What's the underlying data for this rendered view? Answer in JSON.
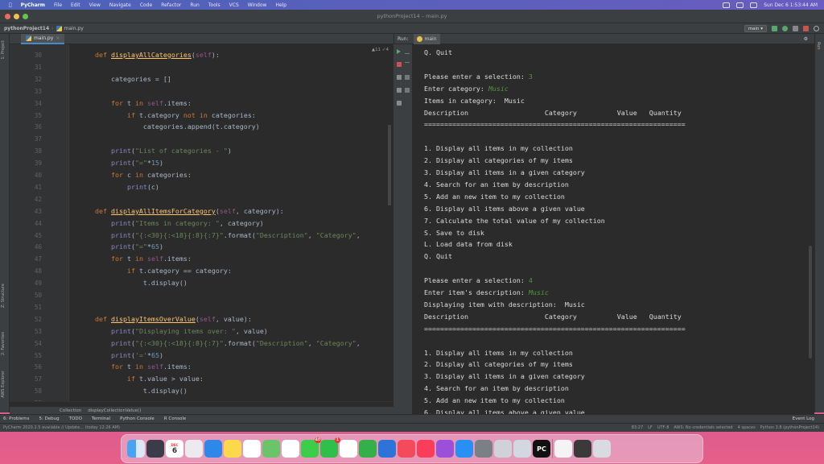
{
  "menubar": {
    "app": "PyCharm",
    "items": [
      "File",
      "Edit",
      "View",
      "Navigate",
      "Code",
      "Refactor",
      "Run",
      "Tools",
      "VCS",
      "Window",
      "Help"
    ],
    "clock": "Sun Dec 6  1:53:44 AM"
  },
  "window": {
    "title": "pythonProject14 – main.py"
  },
  "navbar": {
    "project": "pythonProject14",
    "file": "main.py",
    "run_config": "main"
  },
  "editor": {
    "tab": "main.py",
    "inspections": "▲11 ✓4",
    "lines": [
      {
        "n": "30",
        "t": [
          [
            "    ",
            "p"
          ],
          [
            "def ",
            "kw"
          ],
          [
            "displayAllCategories",
            "fnu"
          ],
          [
            "(",
            "p"
          ],
          [
            "self",
            "sf"
          ],
          [
            "):",
            "p"
          ]
        ]
      },
      {
        "n": "31",
        "t": []
      },
      {
        "n": "32",
        "t": [
          [
            "        categories = []",
            "p"
          ]
        ]
      },
      {
        "n": "33",
        "t": []
      },
      {
        "n": "34",
        "t": [
          [
            "        ",
            "p"
          ],
          [
            "for ",
            "kw"
          ],
          [
            "t ",
            "p"
          ],
          [
            "in ",
            "kw"
          ],
          [
            "self",
            "sf"
          ],
          [
            ".items:",
            "p"
          ]
        ]
      },
      {
        "n": "35",
        "t": [
          [
            "            ",
            "p"
          ],
          [
            "if ",
            "kw"
          ],
          [
            "t.category ",
            "p"
          ],
          [
            "not in ",
            "kw"
          ],
          [
            "categories:",
            "p"
          ]
        ]
      },
      {
        "n": "36",
        "t": [
          [
            "                categories.append(t.category)",
            "p"
          ]
        ]
      },
      {
        "n": "37",
        "t": []
      },
      {
        "n": "38",
        "t": [
          [
            "        ",
            "p"
          ],
          [
            "print",
            "nb"
          ],
          [
            "(",
            "p"
          ],
          [
            "\"List of categories - \"",
            "st"
          ],
          [
            ")",
            "p"
          ]
        ]
      },
      {
        "n": "39",
        "t": [
          [
            "        ",
            "p"
          ],
          [
            "print",
            "nb"
          ],
          [
            "(",
            "p"
          ],
          [
            "\"=\"",
            "st"
          ],
          [
            "*",
            "p"
          ],
          [
            "15",
            "num"
          ],
          [
            ")",
            "p"
          ]
        ]
      },
      {
        "n": "40",
        "t": [
          [
            "        ",
            "p"
          ],
          [
            "for ",
            "kw"
          ],
          [
            "c ",
            "p"
          ],
          [
            "in ",
            "kw"
          ],
          [
            "categories:",
            "p"
          ]
        ]
      },
      {
        "n": "41",
        "t": [
          [
            "            ",
            "p"
          ],
          [
            "print",
            "nb"
          ],
          [
            "(c)",
            "p"
          ]
        ]
      },
      {
        "n": "42",
        "t": []
      },
      {
        "n": "43",
        "t": [
          [
            "    ",
            "p"
          ],
          [
            "def ",
            "kw"
          ],
          [
            "displayAllItemsForCategory",
            "fnu"
          ],
          [
            "(",
            "p"
          ],
          [
            "self",
            "sf"
          ],
          [
            ", category):",
            "p"
          ]
        ]
      },
      {
        "n": "44",
        "t": [
          [
            "        ",
            "p"
          ],
          [
            "print",
            "nb"
          ],
          [
            "(",
            "p"
          ],
          [
            "\"Items in category: \"",
            "st"
          ],
          [
            ", category)",
            "p"
          ]
        ]
      },
      {
        "n": "45",
        "t": [
          [
            "        ",
            "p"
          ],
          [
            "print",
            "nb"
          ],
          [
            "(",
            "p"
          ],
          [
            "\"{:<30}{:<18}{:8}{:7}\"",
            "st"
          ],
          [
            ".format(",
            "p"
          ],
          [
            "\"Description\"",
            "st"
          ],
          [
            ", ",
            "p"
          ],
          [
            "\"Category\"",
            "st"
          ],
          [
            ",",
            "p"
          ]
        ]
      },
      {
        "n": "46",
        "t": [
          [
            "        ",
            "p"
          ],
          [
            "print",
            "nb"
          ],
          [
            "(",
            "p"
          ],
          [
            "\"=\"",
            "st"
          ],
          [
            "*",
            "p"
          ],
          [
            "65",
            "num"
          ],
          [
            ")",
            "p"
          ]
        ]
      },
      {
        "n": "47",
        "t": [
          [
            "        ",
            "p"
          ],
          [
            "for ",
            "kw"
          ],
          [
            "t ",
            "p"
          ],
          [
            "in ",
            "kw"
          ],
          [
            "self",
            "sf"
          ],
          [
            ".items:",
            "p"
          ]
        ]
      },
      {
        "n": "48",
        "t": [
          [
            "            ",
            "p"
          ],
          [
            "if ",
            "kw"
          ],
          [
            "t.category == category:",
            "p"
          ]
        ]
      },
      {
        "n": "49",
        "t": [
          [
            "                t.display()",
            "p"
          ]
        ]
      },
      {
        "n": "50",
        "t": []
      },
      {
        "n": "51",
        "t": []
      },
      {
        "n": "52",
        "t": [
          [
            "    ",
            "p"
          ],
          [
            "def ",
            "kw"
          ],
          [
            "displayItemsOverValue",
            "fnu"
          ],
          [
            "(",
            "p"
          ],
          [
            "self",
            "sf"
          ],
          [
            ", value):",
            "p"
          ]
        ]
      },
      {
        "n": "53",
        "t": [
          [
            "        ",
            "p"
          ],
          [
            "print",
            "nb"
          ],
          [
            "(",
            "p"
          ],
          [
            "\"Displaying items over: \"",
            "st"
          ],
          [
            ", value)",
            "p"
          ]
        ]
      },
      {
        "n": "54",
        "t": [
          [
            "        ",
            "p"
          ],
          [
            "print",
            "nb"
          ],
          [
            "(",
            "p"
          ],
          [
            "\"{:<30}{:<18}{:8}{:7}\"",
            "st"
          ],
          [
            ".format(",
            "p"
          ],
          [
            "\"Description\"",
            "st"
          ],
          [
            ", ",
            "p"
          ],
          [
            "\"Category\"",
            "st"
          ],
          [
            ",",
            "p"
          ]
        ]
      },
      {
        "n": "55",
        "t": [
          [
            "        ",
            "p"
          ],
          [
            "print",
            "nb"
          ],
          [
            "(",
            "p"
          ],
          [
            "'='",
            "st"
          ],
          [
            "*",
            "p"
          ],
          [
            "65",
            "num"
          ],
          [
            ")",
            "p"
          ]
        ]
      },
      {
        "n": "56",
        "t": [
          [
            "        ",
            "p"
          ],
          [
            "for ",
            "kw"
          ],
          [
            "t ",
            "p"
          ],
          [
            "in ",
            "kw"
          ],
          [
            "self",
            "sf"
          ],
          [
            ".items:",
            "p"
          ]
        ]
      },
      {
        "n": "57",
        "t": [
          [
            "            ",
            "p"
          ],
          [
            "if ",
            "kw"
          ],
          [
            "t.value > value:",
            "p"
          ]
        ]
      },
      {
        "n": "58",
        "t": [
          [
            "                t.display()",
            "p"
          ]
        ]
      },
      {
        "n": "59",
        "t": []
      }
    ],
    "breadcrumb": [
      "Collection",
      "displayCollectionValue()"
    ]
  },
  "run": {
    "label": "Run:",
    "tab": "main",
    "lines": [
      [
        [
          "Q. Quit",
          "o"
        ]
      ],
      [],
      [
        [
          "Please enter a selection: ",
          "o"
        ],
        [
          "3",
          "in"
        ]
      ],
      [
        [
          "Enter category: ",
          "o"
        ],
        [
          "Music",
          "inc"
        ]
      ],
      [
        [
          "Items in category:  Music",
          "o"
        ]
      ],
      [
        [
          "Description                   Category          Value   Quantity",
          "o"
        ]
      ],
      [
        [
          "=================================================================",
          "o"
        ]
      ],
      [],
      [
        [
          "1. Display all items in my collection",
          "o"
        ]
      ],
      [
        [
          "2. Display all categories of my items",
          "o"
        ]
      ],
      [
        [
          "3. Display all items in a given category",
          "o"
        ]
      ],
      [
        [
          "4. Search for an item by description",
          "o"
        ]
      ],
      [
        [
          "5. Add an new item to my collection",
          "o"
        ]
      ],
      [
        [
          "6. Display all items above a given value",
          "o"
        ]
      ],
      [
        [
          "7. Calculate the total value of my collection",
          "o"
        ]
      ],
      [
        [
          "S. Save to disk",
          "o"
        ]
      ],
      [
        [
          "L. Load data from disk",
          "o"
        ]
      ],
      [
        [
          "Q. Quit",
          "o"
        ]
      ],
      [],
      [
        [
          "Please enter a selection: ",
          "o"
        ],
        [
          "4",
          "in"
        ]
      ],
      [
        [
          "Enter item's description: ",
          "o"
        ],
        [
          "Music",
          "inc"
        ]
      ],
      [
        [
          "Displaying item with description:  Music",
          "o"
        ]
      ],
      [
        [
          "Description                   Category          Value   Quantity",
          "o"
        ]
      ],
      [
        [
          "=================================================================",
          "o"
        ]
      ],
      [],
      [
        [
          "1. Display all items in my collection",
          "o"
        ]
      ],
      [
        [
          "2. Display all categories of my items",
          "o"
        ]
      ],
      [
        [
          "3. Display all items in a given category",
          "o"
        ]
      ],
      [
        [
          "4. Search for an item by description",
          "o"
        ]
      ],
      [
        [
          "5. Add an new item to my collection",
          "o"
        ]
      ],
      [
        [
          "6. Display all items above a given value",
          "o"
        ]
      ]
    ]
  },
  "left_tools": [
    "1: Project",
    "Z: Structure",
    "2: Favorites",
    "AWS Explorer"
  ],
  "right_tools": [
    "Run"
  ],
  "tool_tabs": [
    "6: Problems",
    "5: Debug",
    "TODO",
    "Terminal",
    "Python Console",
    "R Console"
  ],
  "event_log": "Event Log",
  "status": {
    "left": "PyCharm 2020.2.5 available // Update... (today 12:26 AM)",
    "right": [
      "83:27",
      "LF",
      "UTF-8",
      "AWS: No credentials selected",
      "4 spaces",
      "Python 3.8 (pythonProject14)"
    ]
  },
  "dock": {
    "calendar_day": "6",
    "calendar_month": "DEC",
    "badges": [
      "40",
      "1"
    ],
    "icons": [
      "finder-icon",
      "launchpad-icon",
      "calendar-icon",
      "apps-grid-icon",
      "safari-icon",
      "notes-icon",
      "reminders-icon",
      "maps-icon",
      "photos-icon",
      "messages-icon",
      "facetime-icon",
      "pencil-icon",
      "numbers-icon",
      "keynote-icon",
      "news-icon",
      "music-icon",
      "podcasts-icon",
      "app-store-icon",
      "system-preferences-icon",
      "image-capture-icon",
      "screen-icon",
      "pycharm-icon",
      "document-icon",
      "window-icon",
      "trash-icon"
    ]
  }
}
